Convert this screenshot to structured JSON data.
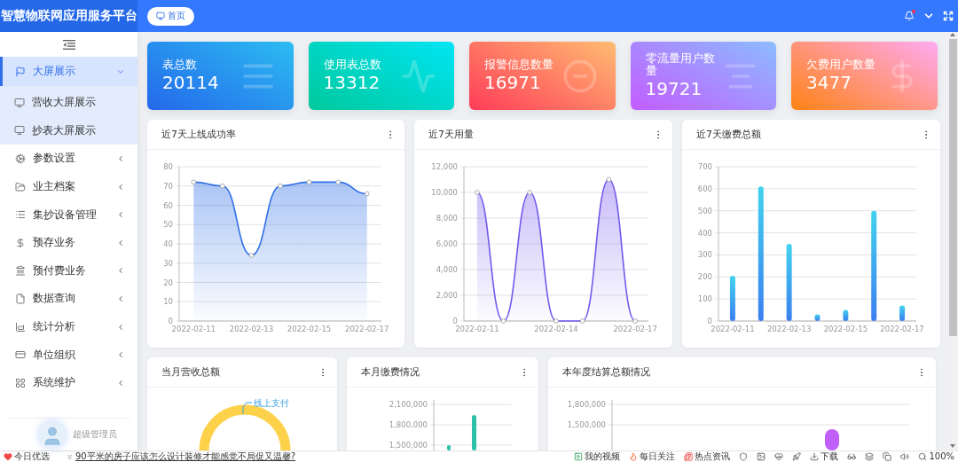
{
  "app": {
    "title": "智慧物联网应用服务平台"
  },
  "header": {
    "home_button": "首页"
  },
  "sidebar": {
    "items": [
      {
        "label": "大屏展示",
        "selected": true,
        "expanded": true,
        "children": [
          {
            "label": "营收大屏展示",
            "selected": false
          },
          {
            "label": "抄表大屏展示",
            "selected": false
          }
        ]
      },
      {
        "label": "参数设置",
        "selected": false,
        "expanded": false
      },
      {
        "label": "业主档案",
        "selected": false,
        "expanded": false
      },
      {
        "label": "集抄设备管理",
        "selected": false,
        "expanded": false
      },
      {
        "label": "预存业务",
        "selected": false,
        "expanded": false
      },
      {
        "label": "预付费业务",
        "selected": false,
        "expanded": false
      },
      {
        "label": "数据查询",
        "selected": false,
        "expanded": false
      },
      {
        "label": "统计分析",
        "selected": false,
        "expanded": false
      },
      {
        "label": "单位组织",
        "selected": false,
        "expanded": false
      },
      {
        "label": "系统维护",
        "selected": false,
        "expanded": false
      }
    ],
    "user": {
      "name": "超级管理员"
    }
  },
  "stats": [
    {
      "label": "表总数",
      "value": "20114"
    },
    {
      "label": "使用表总数",
      "value": "13312"
    },
    {
      "label": "报警信息数量",
      "value": "16971"
    },
    {
      "label": "零流量用户数量",
      "value": "19721"
    },
    {
      "label": "欠费用户数量",
      "value": "3477"
    }
  ],
  "charts": [
    {
      "chart_data": {
        "type": "line",
        "title": "近7天上线成功率",
        "grid": true,
        "categories": [
          "2022-02-11",
          null,
          "2022-02-13",
          null,
          "2022-02-15",
          null,
          "2022-02-17"
        ],
        "series": [
          {
            "type": "area",
            "color": "#2f6fe8",
            "values": [
              72,
              70,
              34,
              70,
              72,
              72,
              66
            ]
          }
        ],
        "ylim": [
          0,
          80
        ],
        "yticks": [
          0,
          10,
          20,
          30,
          40,
          50,
          60,
          70,
          80
        ]
      }
    },
    {
      "chart_data": {
        "type": "line",
        "title": "近7天用量",
        "grid": true,
        "categories": [
          "2022-02-11",
          null,
          null,
          "2022-02-14",
          null,
          null,
          "2022-02-17"
        ],
        "series": [
          {
            "type": "area",
            "color": "#7457ee",
            "values": [
              10000,
              0,
              10000,
              0,
              0,
              11000,
              0
            ]
          }
        ],
        "ylim": [
          0,
          12000
        ],
        "yticks": [
          {
            "value": 0,
            "label": "0"
          },
          {
            "value": 2000,
            "label": "2,000"
          },
          {
            "value": 4000,
            "label": "4,000"
          },
          {
            "value": 6000,
            "label": "6,000"
          },
          {
            "value": 8000,
            "label": "8,000"
          },
          {
            "value": 10000,
            "label": "10,000"
          },
          {
            "value": 12000,
            "label": "12,000"
          }
        ]
      }
    },
    {
      "chart_data": {
        "type": "bar",
        "title": "近7天缴费总额",
        "grid": true,
        "categories": [
          "2022-02-11",
          null,
          "2022-02-13",
          null,
          "2022-02-15",
          null,
          "2022-02-17"
        ],
        "series": [
          {
            "color": "#42d2ee",
            "values": [
              205,
              610,
              350,
              30,
              50,
              500,
              70
            ]
          }
        ],
        "ylim": [
          0,
          700
        ],
        "yticks": [
          0,
          100,
          200,
          300,
          400,
          500,
          600,
          700
        ]
      }
    }
  ],
  "panels": [
    {
      "title": "当月营收总额",
      "kind": "donut",
      "labels": [
        "线上支付"
      ]
    },
    {
      "title": "本月缴费情况",
      "kind": "bars",
      "axis_labels": [
        "2,100,000",
        "1,800,000",
        "1,500,000"
      ]
    },
    {
      "title": "本年度结算总额情况",
      "kind": "bars",
      "axis_labels": [
        "1,800,000",
        "1,500,000"
      ]
    }
  ],
  "status_bar": {
    "today": "今日优选",
    "headline": "90平米的房子应该怎么设计装修才能感觉不局促又温馨?",
    "links": [
      "我的视频",
      "每日关注",
      "热点资讯"
    ],
    "download": "下载",
    "zoom": "100%"
  }
}
